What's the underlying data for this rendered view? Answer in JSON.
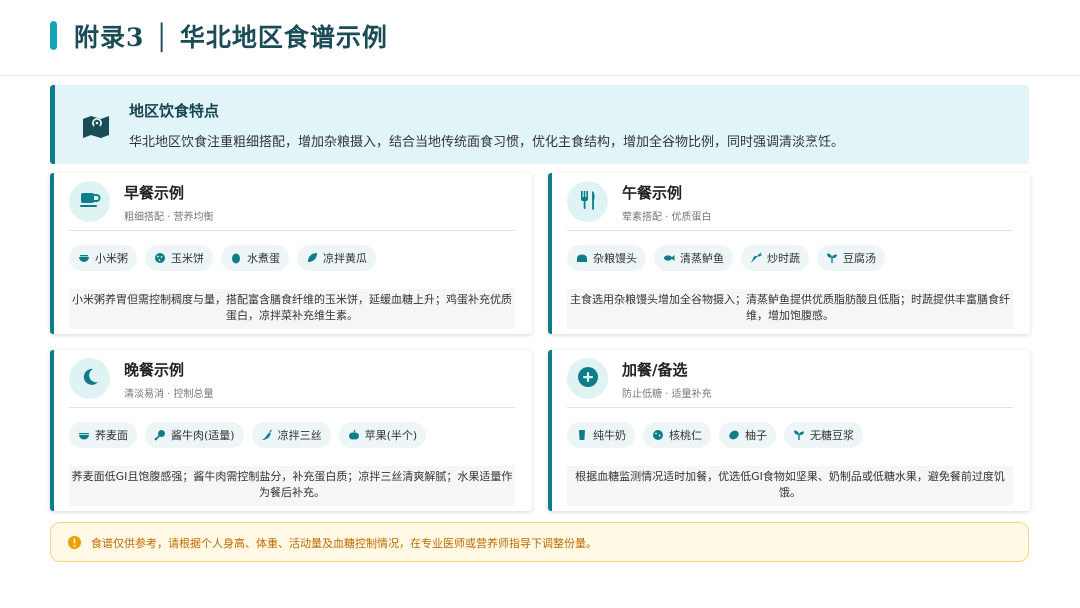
{
  "header": {
    "title": "附录3 │ 华北地区食谱示例"
  },
  "feature": {
    "icon": "map-icon",
    "title": "地区饮食特点",
    "text": "华北地区饮食注重粗细搭配，增加杂粮摄入，结合当地传统面食习惯，优化主食结构，增加全谷物比例，同时强调清淡烹饪。"
  },
  "cards": [
    {
      "icon": "coffee-cup-icon",
      "title": "早餐示例",
      "subtitle": "粗细搭配 · 营养均衡",
      "chips": [
        {
          "icon": "bowl-icon",
          "label": "小米粥"
        },
        {
          "icon": "cookie-icon",
          "label": "玉米饼"
        },
        {
          "icon": "egg-icon",
          "label": "水煮蛋"
        },
        {
          "icon": "leaf-icon",
          "label": "凉拌黄瓜"
        }
      ],
      "desc": "小米粥养胃但需控制稠度与量，搭配富含膳食纤维的玉米饼，延缓血糖上升；鸡蛋补充优质蛋白，凉拌菜补充维生素。"
    },
    {
      "icon": "utensils-icon",
      "title": "午餐示例",
      "subtitle": "荤素搭配 · 优质蛋白",
      "chips": [
        {
          "icon": "bread-icon",
          "label": "杂粮馒头"
        },
        {
          "icon": "fish-icon",
          "label": "清蒸鲈鱼"
        },
        {
          "icon": "carrot-icon",
          "label": "炒时蔬"
        },
        {
          "icon": "seedling-icon",
          "label": "豆腐汤"
        }
      ],
      "desc": "主食选用杂粮馒头增加全谷物摄入；清蒸鲈鱼提供优质脂肪酸且低脂；时蔬提供丰富膳食纤维，增加饱腹感。"
    },
    {
      "icon": "moon-icon",
      "title": "晚餐示例",
      "subtitle": "清淡易消 · 控制总量",
      "chips": [
        {
          "icon": "noodle-bowl-icon",
          "label": "荞麦面"
        },
        {
          "icon": "drumstick-icon",
          "label": "酱牛肉(适量)"
        },
        {
          "icon": "pepper-icon",
          "label": "凉拌三丝"
        },
        {
          "icon": "apple-icon",
          "label": "苹果(半个)"
        }
      ],
      "desc": "荞麦面低GI且饱腹感强；酱牛肉需控制盐分，补充蛋白质；凉拌三丝清爽解腻；水果适量作为餐后补充。"
    },
    {
      "icon": "plus-circle-icon",
      "title": "加餐/备选",
      "subtitle": "防止低糖 · 适量补充",
      "chips": [
        {
          "icon": "milk-icon",
          "label": "纯牛奶"
        },
        {
          "icon": "nut-icon",
          "label": "核桃仁"
        },
        {
          "icon": "lemon-icon",
          "label": "柚子"
        },
        {
          "icon": "sprout-icon",
          "label": "无糖豆浆"
        }
      ],
      "desc": "根据血糖监测情况适时加餐，优选低GI食物如坚果、奶制品或低糖水果，避免餐前过度饥饿。"
    }
  ],
  "note": {
    "icon": "info-icon",
    "text": "食谱仅供参考，请根据个人身高、体重、活动量及血糖控制情况，在专业医师或营养师指导下调整份量。"
  },
  "colors": {
    "accent": "#14a4b8",
    "teal_dark": "#0d7e89",
    "feature_bg": "#e1f5f8",
    "note_bg": "#fff9e5",
    "note_text": "#c06a00"
  }
}
